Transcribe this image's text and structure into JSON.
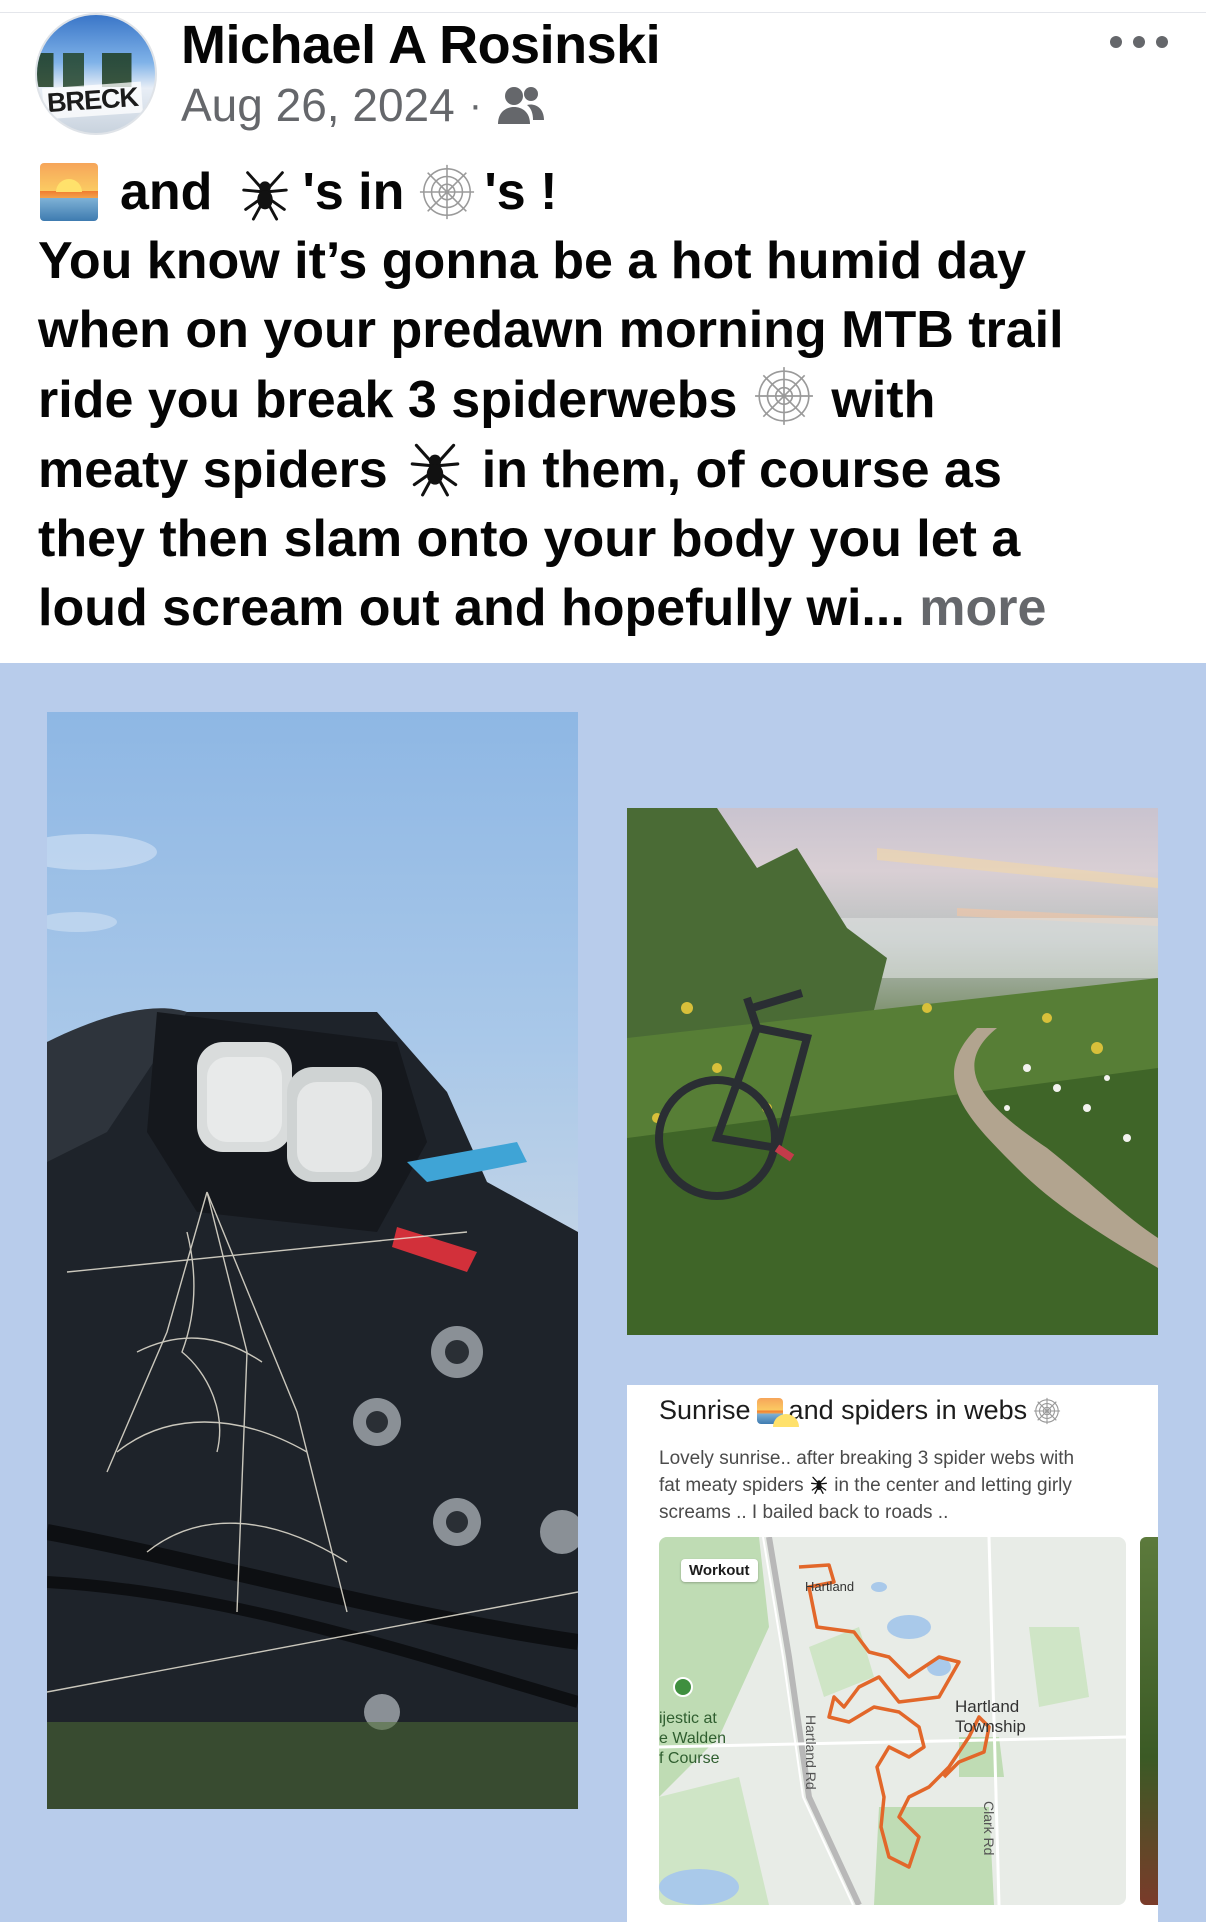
{
  "post": {
    "author": "Michael A Rosinski",
    "date": "Aug 26, 2024",
    "date_separator": "·",
    "avatar_text": "BRECK",
    "headline_and": "and",
    "headline_s_in": "'s in",
    "headline_s_end": "'s !",
    "text_lines": [
      "You know it’s gonna be a hot humid day",
      "when on your predawn morning MTB trail",
      "ride you break 3 spiderwebs",
      "with",
      "meaty spiders",
      "in them, of course as",
      "they then slam onto your body you let a",
      "loud scream out and hopefully wi..."
    ],
    "more_label": "more",
    "icons": {
      "options": "more-options-icon",
      "audience": "friends-icon",
      "sunrise": "sunrise-emoji",
      "spider": "spider-emoji",
      "web": "spiderweb-emoji"
    }
  },
  "workout": {
    "title_a": "Sunrise",
    "title_b": "and spiders in webs",
    "desc_lines": [
      "Lovely sunrise.. after breaking 3 spider webs with",
      "fat meaty spiders",
      "in the center and letting girly",
      "screams .. I bailed back to roads .."
    ],
    "badge": "Workout",
    "map_labels": {
      "hartland": "Hartland",
      "township_line1": "Hartland",
      "township_line2": "Township",
      "golf_line1": "ijestic at",
      "golf_line2": "e Walden",
      "golf_line3": "f Course",
      "road_hartland": "Hartland Rd",
      "road_clark": "Clark Rd"
    }
  },
  "colors": {
    "media_background": "#b8cceb",
    "secondary_text": "#65676b",
    "route": "#e2672a"
  }
}
